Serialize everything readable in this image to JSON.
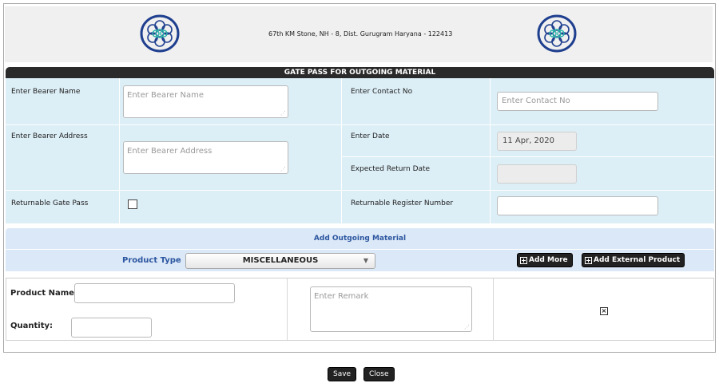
{
  "header": {
    "address": "67th KM Stone, NH - 8, Dist. Gurugram Haryana - 122413",
    "logo_icon": "flower-logo-icon"
  },
  "form": {
    "title": "GATE PASS FOR OUTGOING MATERIAL",
    "bearer_name_label": "Enter Bearer Name",
    "bearer_name_placeholder": "Enter Bearer Name",
    "contact_label": "Enter Contact No",
    "contact_placeholder": "Enter Contact No",
    "bearer_address_label": "Enter Bearer Address",
    "bearer_address_placeholder": "Enter Bearer Address",
    "date_label": "Enter Date",
    "date_value": "11 Apr, 2020",
    "expected_return_label": "Expected Return Date",
    "returnable_label": "Returnable Gate Pass",
    "returnable_register_label": "Returnable Register Number"
  },
  "material": {
    "section_title": "Add Outgoing Material",
    "product_type_label": "Product Type",
    "product_type_value": "MISCELLANEOUS",
    "add_more_label": "Add More",
    "add_external_label": "Add External Product",
    "product_name_label": "Product Name:",
    "quantity_label": "Quantity:",
    "remark_placeholder": "Enter Remark",
    "remove_icon": "close-box-icon"
  },
  "actions": {
    "save_label": "Save",
    "close_label": "Close"
  },
  "colors": {
    "title_bar": "#2a2a2a",
    "form_bg": "#dceef6",
    "section_bg": "#dbe8f7",
    "accent_text": "#2c56a0"
  }
}
